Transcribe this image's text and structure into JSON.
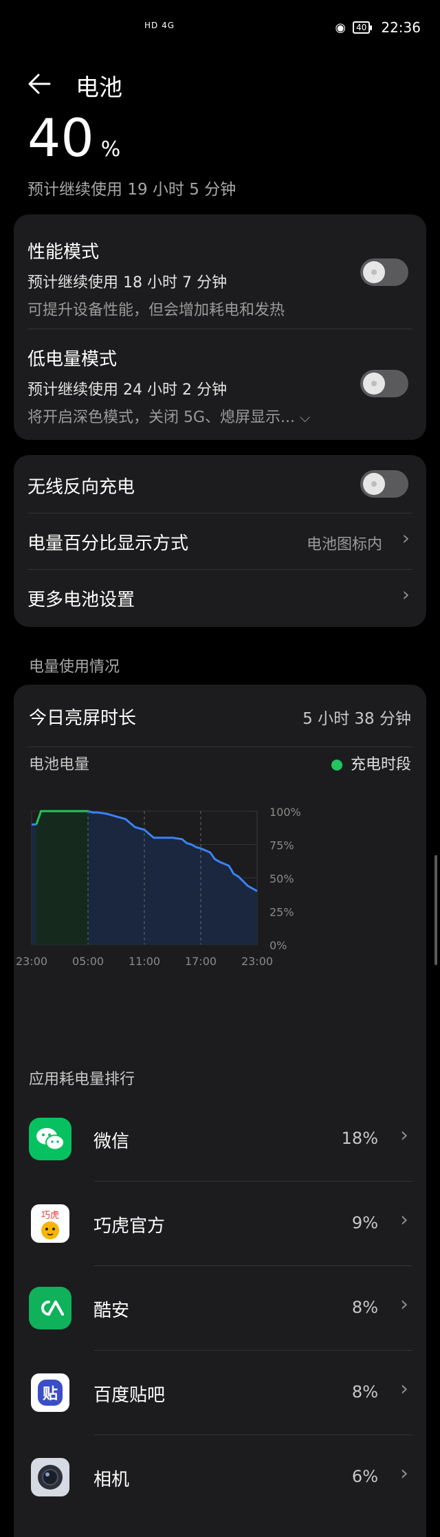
{
  "status_bar": {
    "network": "HD 4G",
    "time": "22:36",
    "battery": "40"
  },
  "header": {
    "title": "电池"
  },
  "battery": {
    "percent": "40",
    "unit": "%",
    "remaining": "预计继续使用 19 小时 5 分钟"
  },
  "modes": [
    {
      "title": "性能模式",
      "line1": "预计继续使用 18 小时 7 分钟",
      "line2": "可提升设备性能，但会增加耗电和发热",
      "enabled": false
    },
    {
      "title": "低电量模式",
      "line1": "预计继续使用 24 小时 2 分钟",
      "line2": "将开启深色模式，关闭 5G、熄屏显示...",
      "enabled": false
    }
  ],
  "settings": {
    "wireless_reverse": {
      "label": "无线反向充电",
      "enabled": false
    },
    "percent_display": {
      "label": "电量百分比显示方式",
      "value": "电池图标内"
    },
    "more": {
      "label": "更多电池设置"
    }
  },
  "usage_section_label": "电量使用情况",
  "usage": {
    "screen_time_label": "今日亮屏时长",
    "screen_time_value": "5 小时 38 分钟",
    "battery_level_label": "电池电量",
    "legend_charging": "充电时段"
  },
  "chart_data": {
    "type": "area",
    "x_ticks": [
      "23:00",
      "05:00",
      "11:00",
      "17:00",
      "23:00"
    ],
    "y_ticks": [
      "100%",
      "75%",
      "50%",
      "25%",
      "0%"
    ],
    "ylim": [
      0,
      100
    ],
    "x_hours": [
      0,
      0.5,
      1,
      2,
      3,
      4,
      5,
      6,
      6.5,
      7,
      8,
      9,
      9.5,
      10,
      10.5,
      11,
      12,
      12.5,
      13,
      14,
      15,
      16,
      16.5,
      17,
      17.5,
      18,
      19,
      19.5,
      20,
      21,
      21.5,
      22,
      23,
      24
    ],
    "values": [
      90,
      90,
      100,
      100,
      100,
      100,
      100,
      100,
      99,
      99,
      98,
      96,
      95,
      94,
      91,
      88,
      86,
      83,
      80,
      80,
      80,
      79,
      76,
      75,
      73,
      72,
      69,
      64,
      62,
      59,
      53,
      51,
      44,
      40
    ],
    "charging_window": {
      "start": 0.5,
      "end": 6
    },
    "colors": {
      "line": "#3b82f6",
      "charging": "#23c55e",
      "fill": "#1a2840",
      "charge_fill": "#152a1c"
    }
  },
  "app_ranking_label": "应用耗电量排行",
  "apps": [
    {
      "name": "微信",
      "percent": "18%",
      "icon": "wechat-icon",
      "color": "#07c160"
    },
    {
      "name": "巧虎官方",
      "percent": "9%",
      "icon": "qiaohu-icon",
      "color": "#ffffff"
    },
    {
      "name": "酷安",
      "percent": "8%",
      "icon": "coolapk-icon",
      "color": "#0fb15a"
    },
    {
      "name": "百度贴吧",
      "percent": "8%",
      "icon": "tieba-icon",
      "color": "#ffffff"
    },
    {
      "name": "相机",
      "percent": "6%",
      "icon": "camera-icon",
      "color": "#dfe3ea"
    }
  ]
}
